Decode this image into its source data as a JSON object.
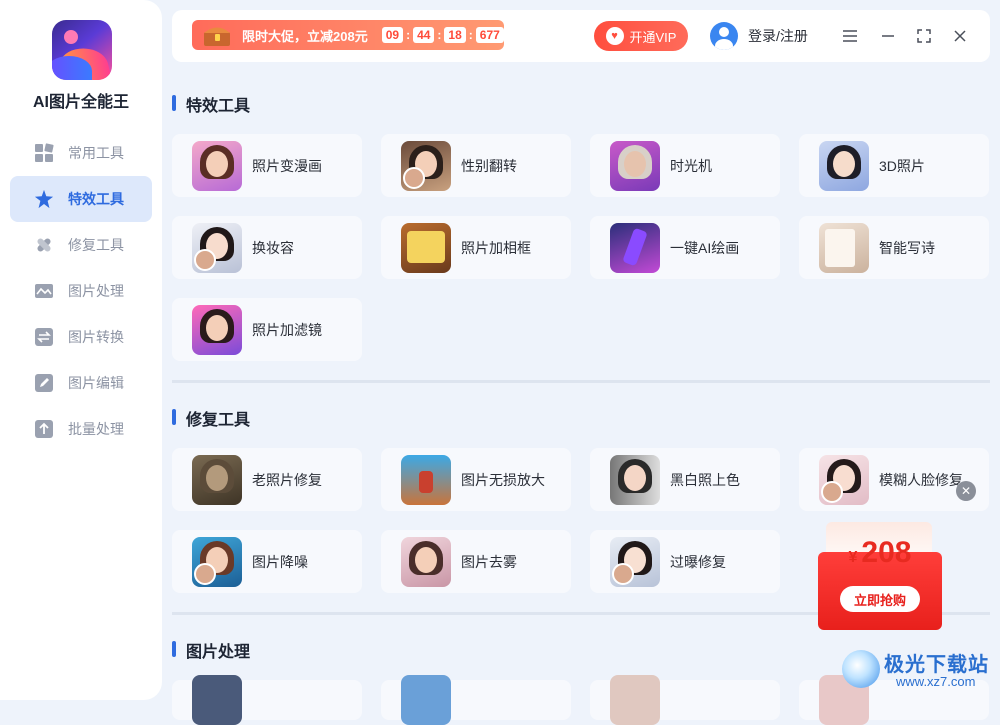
{
  "app": {
    "name": "AI图片全能王"
  },
  "sidebar": {
    "items": [
      {
        "label": "常用工具",
        "icon": "grid-icon",
        "active": false
      },
      {
        "label": "特效工具",
        "icon": "star-icon",
        "active": true
      },
      {
        "label": "修复工具",
        "icon": "bandage-icon",
        "active": false
      },
      {
        "label": "图片处理",
        "icon": "image-icon",
        "active": false
      },
      {
        "label": "图片转换",
        "icon": "convert-icon",
        "active": false
      },
      {
        "label": "图片编辑",
        "icon": "edit-icon",
        "active": false
      },
      {
        "label": "批量处理",
        "icon": "upload-icon",
        "active": false
      }
    ]
  },
  "topbar": {
    "promo_text": "限时大促，立减208元",
    "countdown": [
      "09",
      "44",
      "18",
      "677"
    ],
    "vip_label": "开通VIP",
    "login_label": "登录/注册"
  },
  "sections": [
    {
      "title": "特效工具",
      "cards": [
        "照片变漫画",
        "性别翻转",
        "时光机",
        "3D照片",
        "换妆容",
        "照片加相框",
        "一键AI绘画",
        "智能写诗",
        "照片加滤镜"
      ]
    },
    {
      "title": "修复工具",
      "cards": [
        "老照片修复",
        "图片无损放大",
        "黑白照上色",
        "模糊人脸修复",
        "图片降噪",
        "图片去雾",
        "过曝修复"
      ]
    },
    {
      "title": "图片处理",
      "cards": []
    }
  ],
  "packet": {
    "currency": "¥",
    "amount": "208",
    "cta": "立即抢购"
  },
  "watermark": {
    "title": "极光下载站",
    "url": "www.xz7.com"
  },
  "colors": {
    "accent": "#2f6bdf",
    "promo": "#ff6b5a",
    "vip": "#ff4e3e",
    "packet": "#e8201c"
  }
}
